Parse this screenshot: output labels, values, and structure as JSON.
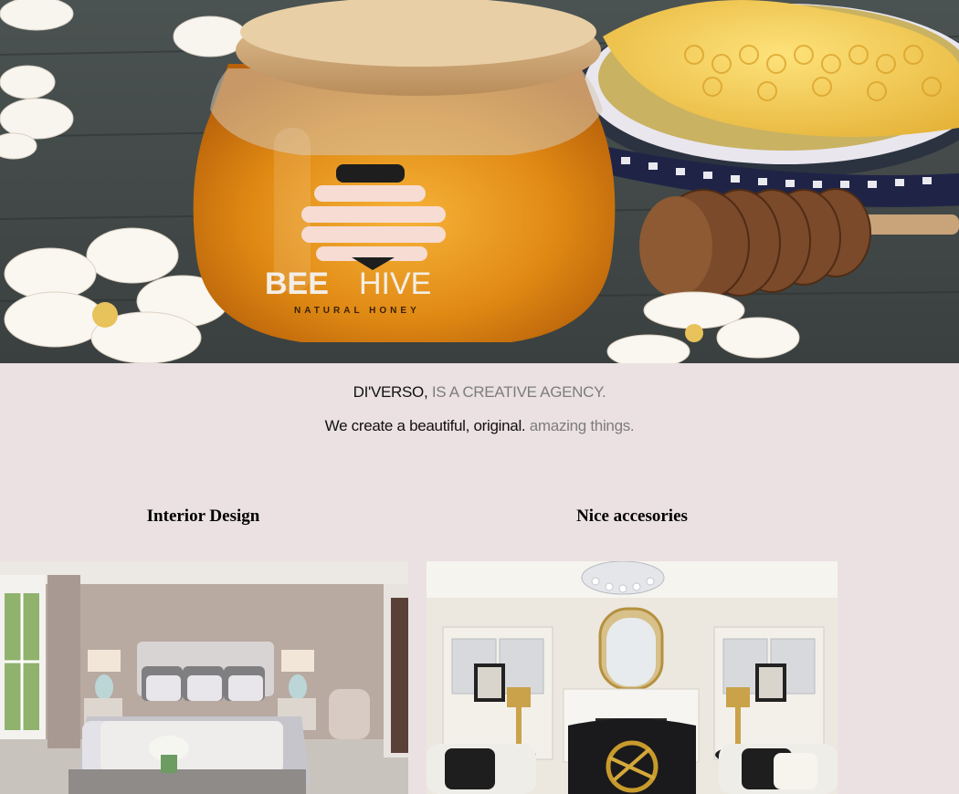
{
  "hero": {
    "brand_main": "BEE",
    "brand_accent": "HIVE",
    "brand_sub": "NATURAL HONEY"
  },
  "tagline": {
    "line1_dark": "DI'VERSO,",
    "line1_muted": "IS A CREATIVE AGENCY.",
    "line2_dark": "We create a beautiful, original.",
    "line2_muted": "amazing things."
  },
  "sections": [
    {
      "title": "Interior Design"
    },
    {
      "title": "Nice accesories"
    }
  ]
}
